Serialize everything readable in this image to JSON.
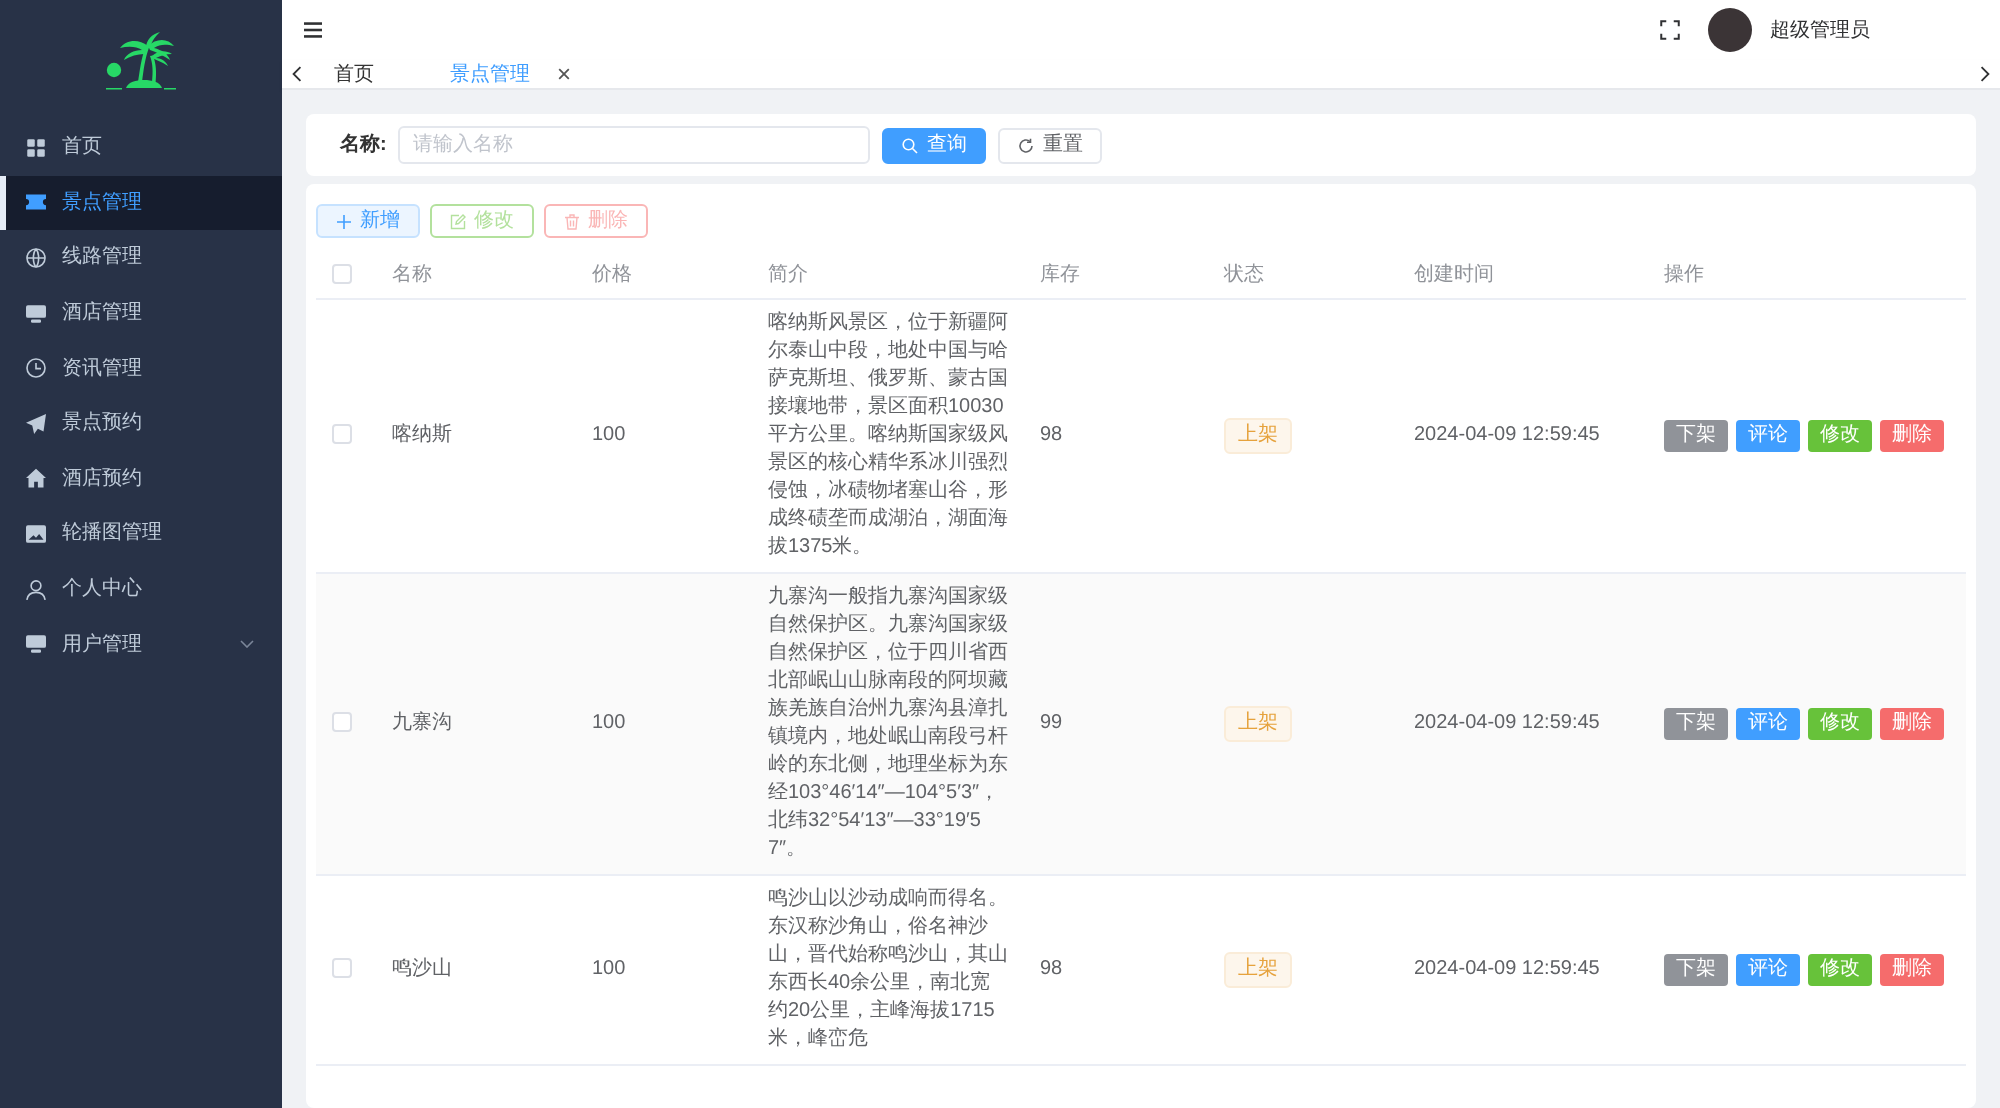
{
  "sidebar": {
    "items": [
      {
        "label": "首页",
        "kind": "item",
        "selected": false
      },
      {
        "label": "景点管理",
        "kind": "item",
        "selected": true
      },
      {
        "label": "线路管理",
        "kind": "item",
        "selected": false
      },
      {
        "label": "酒店管理",
        "kind": "item",
        "selected": false
      },
      {
        "label": "资讯管理",
        "kind": "item",
        "selected": false
      },
      {
        "label": "景点预约",
        "kind": "item",
        "selected": false
      },
      {
        "label": "酒店预约",
        "kind": "item",
        "selected": false
      },
      {
        "label": "轮播图管理",
        "kind": "item",
        "selected": false
      },
      {
        "label": "个人中心",
        "kind": "item",
        "selected": false
      },
      {
        "label": "用户管理",
        "kind": "submenu",
        "selected": false,
        "expanded": false
      }
    ]
  },
  "header": {
    "user_name": "超级管理员"
  },
  "tabs": [
    {
      "label": "首页",
      "selected": false,
      "closable": false
    },
    {
      "label": "景点管理",
      "selected": true,
      "closable": true
    }
  ],
  "search": {
    "label": "名称:",
    "placeholder": "请输入名称",
    "buttons": [
      {
        "label": "查询",
        "kind": "primary"
      },
      {
        "label": "重置",
        "kind": "default"
      }
    ]
  },
  "toolbar": [
    {
      "label": "新增",
      "kind": "primary",
      "disabled": false
    },
    {
      "label": "修改",
      "kind": "success",
      "disabled": true
    },
    {
      "label": "删除",
      "kind": "danger",
      "disabled": true
    }
  ],
  "table": {
    "header_checkbox": {
      "checked": false
    },
    "columns": [
      "名称",
      "价格",
      "简介",
      "库存",
      "状态",
      "创建时间",
      "操作"
    ],
    "rows": [
      {
        "checked": false,
        "name": "喀纳斯",
        "price": "100",
        "intro": "喀纳斯风景区，位于新疆阿尔泰山中段，地处中国与哈萨克斯坦、俄罗斯、蒙古国接壤地带，景区面积10030平方公里。喀纳斯国家级风景区的核心精华系冰川强烈侵蚀，冰碛物堵塞山谷，形成终碛垄而成湖泊，湖面海拔1375米。",
        "stock": "98",
        "status": {
          "label": "上架",
          "kind": "warning"
        },
        "created": "2024-04-09 12:59:45",
        "actions": [
          {
            "label": "下架",
            "kind": "info"
          },
          {
            "label": "评论",
            "kind": "primary"
          },
          {
            "label": "修改",
            "kind": "success"
          },
          {
            "label": "删除",
            "kind": "danger"
          }
        ]
      },
      {
        "checked": false,
        "name": "九寨沟",
        "price": "100",
        "intro": "九寨沟一般指九寨沟国家级自然保护区。九寨沟国家级自然保护区，位于四川省西北部岷山山脉南段的阿坝藏族羌族自治州九寨沟县漳扎镇境内，地处岷山南段弓杆岭的东北侧，地理坐标为东经103°46′14″—104°5′3″，北纬32°54′13″—33°19′57″。",
        "stock": "99",
        "status": {
          "label": "上架",
          "kind": "warning"
        },
        "created": "2024-04-09 12:59:45",
        "actions": [
          {
            "label": "下架",
            "kind": "info"
          },
          {
            "label": "评论",
            "kind": "primary"
          },
          {
            "label": "修改",
            "kind": "success"
          },
          {
            "label": "删除",
            "kind": "danger"
          }
        ]
      },
      {
        "checked": false,
        "name": "鸣沙山",
        "price": "100",
        "intro": "鸣沙山以沙动成响而得名。东汉称沙角山，俗名神沙山，晋代始称鸣沙山，其山东西长40余公里，南北宽约20公里，主峰海拔1715米，峰峦危",
        "stock": "98",
        "status": {
          "label": "上架",
          "kind": "warning"
        },
        "created": "2024-04-09 12:59:45",
        "actions": [
          {
            "label": "下架",
            "kind": "info"
          },
          {
            "label": "评论",
            "kind": "primary"
          },
          {
            "label": "修改",
            "kind": "success"
          },
          {
            "label": "删除",
            "kind": "danger"
          }
        ]
      }
    ]
  }
}
